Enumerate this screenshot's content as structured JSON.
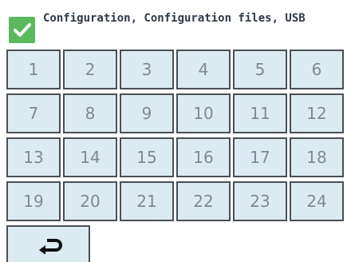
{
  "header": {
    "status_icon": "checkmark-icon",
    "title": "Configuration, Configuration files, USB"
  },
  "grid": {
    "keys": [
      {
        "label": "1"
      },
      {
        "label": "2"
      },
      {
        "label": "3"
      },
      {
        "label": "4"
      },
      {
        "label": "5"
      },
      {
        "label": "6"
      },
      {
        "label": "7"
      },
      {
        "label": "8"
      },
      {
        "label": "9"
      },
      {
        "label": "10"
      },
      {
        "label": "11"
      },
      {
        "label": "12"
      },
      {
        "label": "13"
      },
      {
        "label": "14"
      },
      {
        "label": "15"
      },
      {
        "label": "16"
      },
      {
        "label": "17"
      },
      {
        "label": "18"
      },
      {
        "label": "19"
      },
      {
        "label": "20"
      },
      {
        "label": "21"
      },
      {
        "label": "22"
      },
      {
        "label": "23"
      },
      {
        "label": "24"
      }
    ]
  },
  "footer": {
    "back_icon": "return-arrow-icon"
  },
  "colors": {
    "accent_green": "#5cb85c",
    "key_background": "#dcebf1",
    "key_border": "#4a4f55",
    "key_text": "#7f8a93",
    "title_text": "#2f3a47"
  }
}
